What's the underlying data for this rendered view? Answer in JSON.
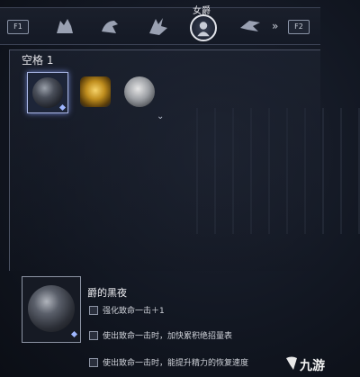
{
  "topbar": {
    "left_key": "F1",
    "right_key": "F2",
    "selected_label": "女爵",
    "next_arrow": "»",
    "icons": [
      "wolf-head-icon",
      "bird-head-icon",
      "dragon-icon",
      "wizard-icon",
      "duchess-icon",
      "raven-icon"
    ]
  },
  "slot": {
    "title": "空格 1",
    "items": [
      {
        "name": "dark-relic",
        "kind": "dark",
        "selected": true
      },
      {
        "name": "gold-relic",
        "kind": "gold",
        "selected": false
      },
      {
        "name": "silver-relic",
        "kind": "silver",
        "selected": false
      }
    ],
    "expand_icon": "⌄"
  },
  "detail": {
    "name": "爵的黑夜",
    "effects": [
      "强化致命一击＋1",
      "使出致命一击时，加快累积绝招量表",
      "使出致命一击时，能提升精力的恢复速度"
    ]
  },
  "watermark": {
    "text": "九游"
  },
  "colors": {
    "accent": "#a9b6e4",
    "background": "#121722",
    "text": "#d8d8dc"
  }
}
